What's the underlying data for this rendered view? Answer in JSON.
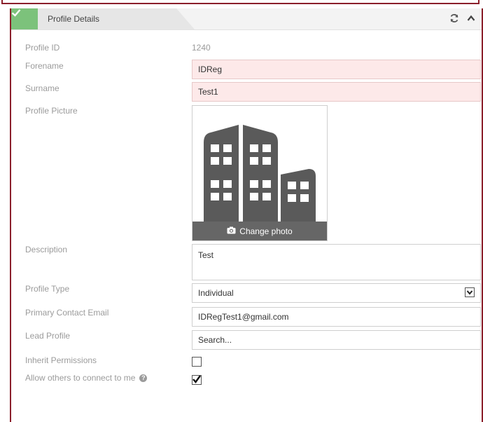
{
  "panel": {
    "title": "Profile Details",
    "check_icon": "check-icon",
    "refresh_icon": "refresh-icon",
    "collapse_icon": "chevron-up-icon"
  },
  "fields": {
    "profile_id": {
      "label": "Profile ID",
      "value": "1240"
    },
    "forename": {
      "label": "Forename",
      "value": "IDReg"
    },
    "surname": {
      "label": "Surname",
      "value": "Test1"
    },
    "profile_picture": {
      "label": "Profile Picture",
      "change_label": "Change photo",
      "camera_icon": "camera-icon",
      "image_icon": "building-icon"
    },
    "description": {
      "label": "Description",
      "value": "Test"
    },
    "profile_type": {
      "label": "Profile Type",
      "value": "Individual"
    },
    "primary_email": {
      "label": "Primary Contact Email",
      "value": "IDRegTest1@gmail.com"
    },
    "lead_profile": {
      "label": "Lead Profile",
      "placeholder": "Search..."
    },
    "inherit_permissions": {
      "label": "Inherit Permissions",
      "checked": false
    },
    "allow_connect": {
      "label": "Allow others to connect to me",
      "checked": true,
      "help_icon": "help-icon"
    }
  },
  "colors": {
    "frame": "#8b1f2b",
    "accent_green": "#7cc27b",
    "required_bg": "#fde9e9",
    "photo_bar": "#666666",
    "building": "#5a5a5a"
  }
}
